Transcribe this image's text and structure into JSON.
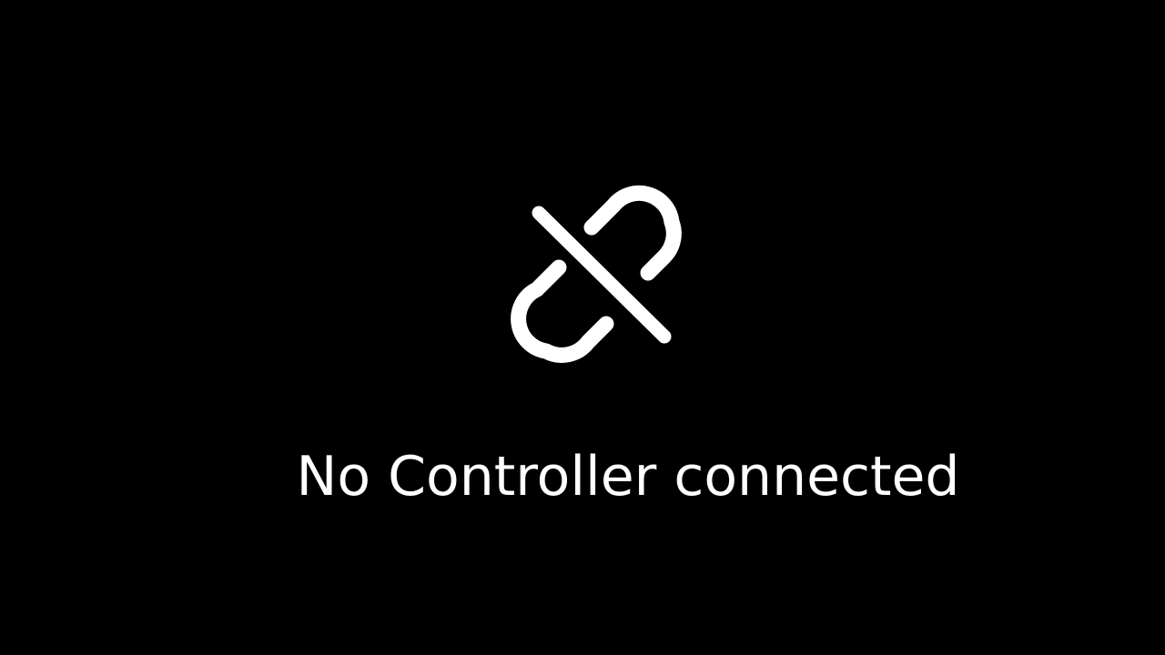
{
  "screen": {
    "message": "No Controller connected",
    "icon": "disconnected-link-icon",
    "colors": {
      "background": "#000000",
      "foreground": "#ffffff"
    }
  }
}
